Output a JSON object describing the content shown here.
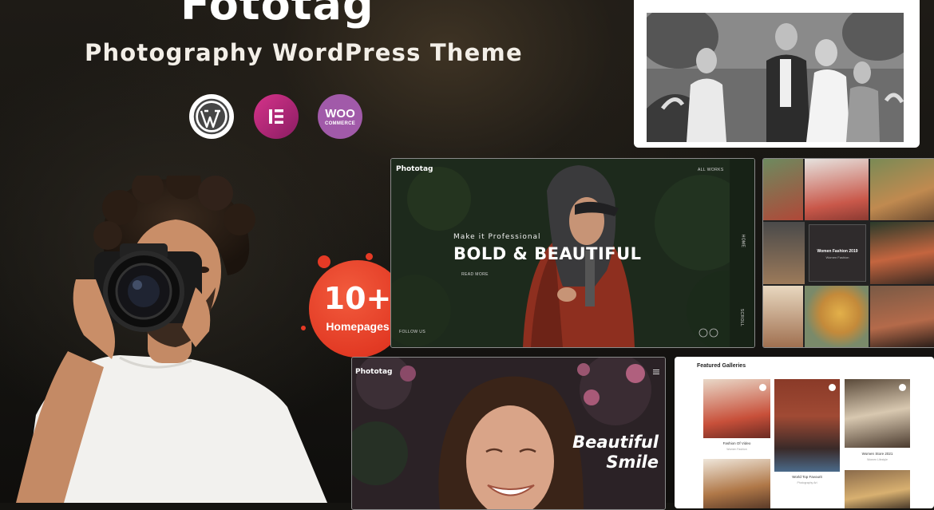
{
  "hero": {
    "title": "Fototag",
    "subtitle": "Photography WordPress Theme"
  },
  "badges": {
    "wordpress_icon": "wordpress-logo",
    "elementor_icon": "elementor-logo",
    "woo_main": "WOO",
    "woo_sub": "COMMERCE"
  },
  "homepages": {
    "count": "10+",
    "label": "Homepages"
  },
  "preview_bold": {
    "logo": "Phototag",
    "nav": "ALL WORKS",
    "kicker": "Make it Professional",
    "title": "BOLD & BEAUTIFUL",
    "cta": "READ MORE",
    "follow": "FOLLOW US",
    "side_top": "HOME",
    "side_bottom": "SCROLL"
  },
  "preview_grid": {
    "center_title": "Women Fashion 2019",
    "center_sub": "Women Fashion"
  },
  "preview_smile": {
    "logo": "Phototag",
    "title_line1": "Beautiful",
    "title_line2": "Smile"
  },
  "preview_featured": {
    "header": "Featured Galleries",
    "items": [
      {
        "caption": "Fashion Of Video",
        "sub": "Women Fashion"
      },
      {
        "caption": "World Top Favourit",
        "sub": "Photography Art"
      },
      {
        "caption": "Women Store 2021",
        "sub": "Women Lifestyle"
      }
    ]
  },
  "colors": {
    "accent": "#e23a24",
    "background": "#141310",
    "elementor": "#92003b",
    "woo": "#a15aa9"
  }
}
